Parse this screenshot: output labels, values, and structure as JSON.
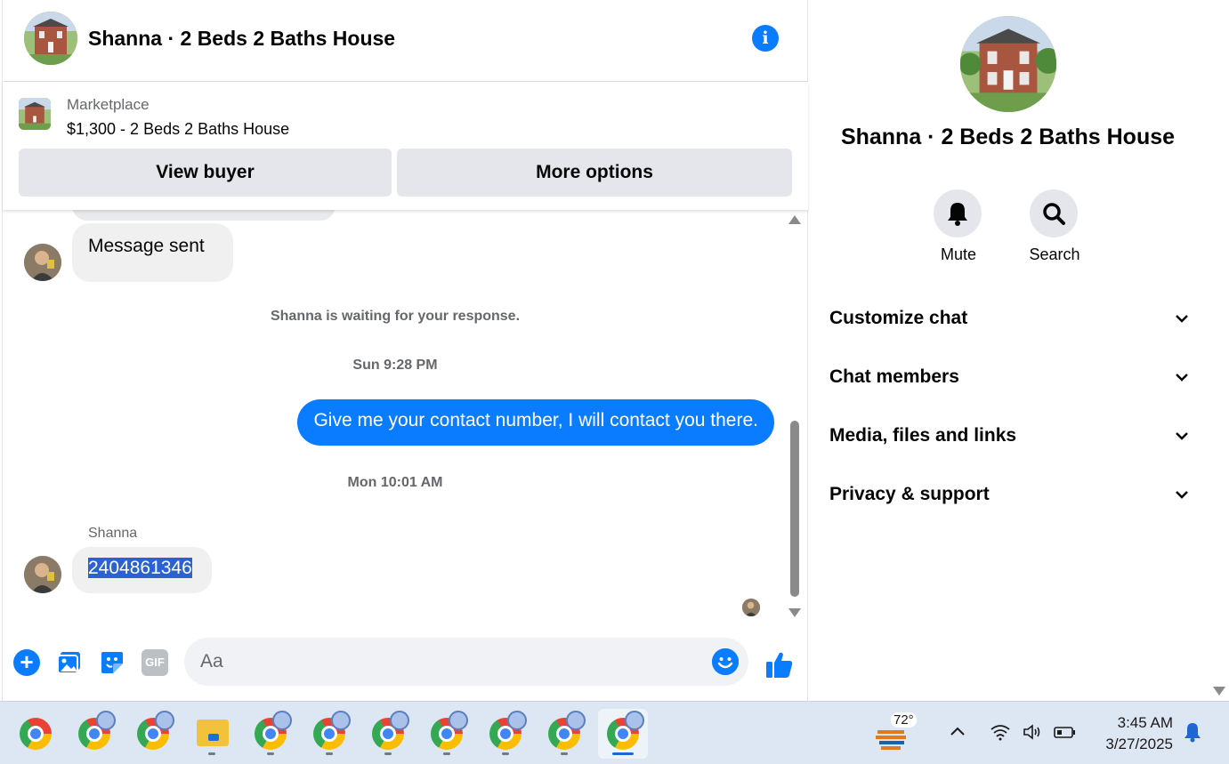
{
  "chat": {
    "title": "Shanna · 2 Beds 2 Baths House",
    "marketplace": {
      "label": "Marketplace",
      "listing": "$1,300 - 2 Beds 2 Baths House",
      "view_buyer_label": "View buyer",
      "more_options_label": "More options"
    },
    "messages": {
      "sent_notice": "Message sent",
      "waiting_text": "Shanna is waiting for your response.",
      "timestamp_1": "Sun 9:28 PM",
      "outgoing_text": "Give me your contact number, I will contact you there.",
      "timestamp_2": "Mon 10:01 AM",
      "sender_name": "Shanna",
      "incoming_number": "2404861346"
    },
    "composer": {
      "placeholder": "Aa",
      "gif_label": "GIF"
    },
    "colors": {
      "accent": "#0a7cff",
      "bubble_in": "#f0f0f0",
      "selection": "#2a62d3"
    }
  },
  "info_panel": {
    "title": "Shanna · 2 Beds 2 Baths House",
    "mute_label": "Mute",
    "search_label": "Search",
    "sections": [
      "Customize chat",
      "Chat members",
      "Media, files and links",
      "Privacy & support"
    ]
  },
  "taskbar": {
    "apps": [
      "chrome-icon",
      "chrome-profile-icon",
      "chrome-profile-icon",
      "file-explorer-icon",
      "chrome-profile-icon",
      "chrome-profile-icon",
      "chrome-profile-icon",
      "chrome-profile-icon",
      "chrome-profile-icon",
      "chrome-profile-icon",
      "chrome-profile-icon"
    ],
    "weather_temp": "72°",
    "time": "3:45 AM",
    "date": "3/27/2025"
  }
}
